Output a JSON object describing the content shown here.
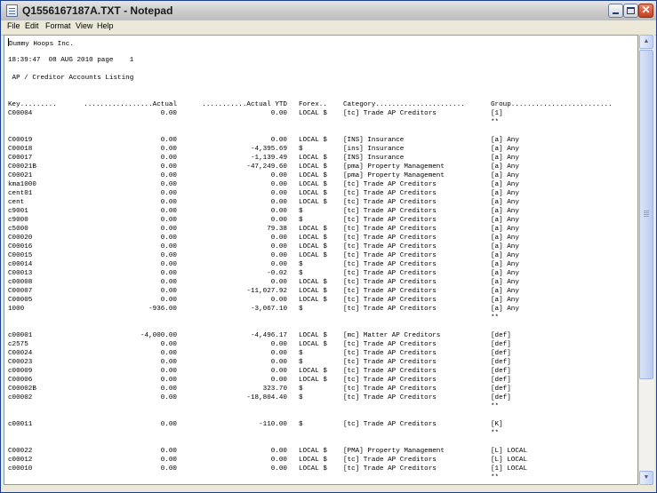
{
  "window": {
    "title": "Q1556167187A.TXT - Notepad"
  },
  "menu": [
    "File",
    "Edit",
    "Format",
    "View",
    "Help"
  ],
  "report": {
    "company": "Dummy Hoops Inc.",
    "header": "18:39:47  08 AUG 2010 page    1",
    "title": " AP / Creditor Accounts Listing",
    "columns": {
      "key": "Key.........",
      "actual": ".................Actual",
      "ytd": "...........Actual YTD",
      "forex": "Forex..",
      "category": "Category......................",
      "group": "Group........................."
    },
    "rows": [
      {
        "key": "C00004",
        "actual": "0.00",
        "ytd": "0.00",
        "forex": "LOCAL $",
        "category": "[tc] Trade AP Creditors",
        "group": "[1]"
      },
      {
        "subtotal": "**"
      },
      {
        "blank": true
      },
      {
        "key": "C00019",
        "actual": "0.00",
        "ytd": "0.00",
        "forex": "LOCAL $",
        "category": "[INS] Insurance",
        "group": "[a] Any"
      },
      {
        "key": "C00018",
        "actual": "0.00",
        "ytd": "-4,395.69",
        "forex": "$",
        "category": "[ins] Insurance",
        "group": "[a] Any"
      },
      {
        "key": "C00017",
        "actual": "0.00",
        "ytd": "-1,139.49",
        "forex": "LOCAL $",
        "category": "[INS] Insurance",
        "group": "[a] Any"
      },
      {
        "key": "C00021B",
        "actual": "0.00",
        "ytd": "-47,249.60",
        "forex": "LOCAL $",
        "category": "[pma] Property Management",
        "group": "[a] Any"
      },
      {
        "key": "C00021",
        "actual": "0.00",
        "ytd": "0.00",
        "forex": "LOCAL $",
        "category": "[pma] Property Management",
        "group": "[a] Any"
      },
      {
        "key": "kma1000",
        "actual": "0.00",
        "ytd": "0.00",
        "forex": "LOCAL $",
        "category": "[tc] Trade AP Creditors",
        "group": "[a] Any"
      },
      {
        "key": "cent01",
        "actual": "0.00",
        "ytd": "0.00",
        "forex": "LOCAL $",
        "category": "[tc] Trade AP Creditors",
        "group": "[a] Any"
      },
      {
        "key": "cent",
        "actual": "0.00",
        "ytd": "0.00",
        "forex": "LOCAL $",
        "category": "[tc] Trade AP Creditors",
        "group": "[a] Any"
      },
      {
        "key": "c9001",
        "actual": "0.00",
        "ytd": "0.00",
        "forex": "$",
        "category": "[tc] Trade AP Creditors",
        "group": "[a] Any"
      },
      {
        "key": "c9000",
        "actual": "0.00",
        "ytd": "0.00",
        "forex": "$",
        "category": "[tc] Trade AP Creditors",
        "group": "[a] Any"
      },
      {
        "key": "c5000",
        "actual": "0.00",
        "ytd": "79.38",
        "forex": "LOCAL $",
        "category": "[tc] Trade AP Creditors",
        "group": "[a] Any"
      },
      {
        "key": "C00020",
        "actual": "0.00",
        "ytd": "0.00",
        "forex": "LOCAL $",
        "category": "[tc] Trade AP Creditors",
        "group": "[a] Any"
      },
      {
        "key": "C00016",
        "actual": "0.00",
        "ytd": "0.00",
        "forex": "LOCAL $",
        "category": "[tc] Trade AP Creditors",
        "group": "[a] Any"
      },
      {
        "key": "C00015",
        "actual": "0.00",
        "ytd": "0.00",
        "forex": "LOCAL $",
        "category": "[tc] Trade AP Creditors",
        "group": "[a] Any"
      },
      {
        "key": "c00014",
        "actual": "0.00",
        "ytd": "0.00",
        "forex": "$",
        "category": "[tc] Trade AP Creditors",
        "group": "[a] Any"
      },
      {
        "key": "C00013",
        "actual": "0.00",
        "ytd": "-0.02",
        "forex": "$",
        "category": "[tc] Trade AP Creditors",
        "group": "[a] Any"
      },
      {
        "key": "c00008",
        "actual": "0.00",
        "ytd": "0.00",
        "forex": "LOCAL $",
        "category": "[tc] Trade AP Creditors",
        "group": "[a] Any"
      },
      {
        "key": "C00007",
        "actual": "0.00",
        "ytd": "-11,027.92",
        "forex": "LOCAL $",
        "category": "[tc] Trade AP Creditors",
        "group": "[a] Any"
      },
      {
        "key": "C00005",
        "actual": "0.00",
        "ytd": "0.00",
        "forex": "LOCAL $",
        "category": "[tc] Trade AP Creditors",
        "group": "[a] Any"
      },
      {
        "key": "1000",
        "actual": "-936.00",
        "ytd": "-3,067.10",
        "forex": "$",
        "category": "[tc] Trade AP Creditors",
        "group": "[a] Any"
      },
      {
        "subtotal": "**"
      },
      {
        "blank": true
      },
      {
        "key": "c00001",
        "actual": "-4,000.00",
        "ytd": "-4,496.17",
        "forex": "LOCAL $",
        "category": "[mc] Matter AP Creditors",
        "group": "[def]"
      },
      {
        "key": "c2575",
        "actual": "0.00",
        "ytd": "0.00",
        "forex": "LOCAL $",
        "category": "[tc] Trade AP Creditors",
        "group": "[def]"
      },
      {
        "key": "C00024",
        "actual": "0.00",
        "ytd": "0.00",
        "forex": "$",
        "category": "[tc] Trade AP Creditors",
        "group": "[def]"
      },
      {
        "key": "C00023",
        "actual": "0.00",
        "ytd": "0.00",
        "forex": "$",
        "category": "[tc] Trade AP Creditors",
        "group": "[def]"
      },
      {
        "key": "c00009",
        "actual": "0.00",
        "ytd": "0.00",
        "forex": "LOCAL $",
        "category": "[tc] Trade AP Creditors",
        "group": "[def]"
      },
      {
        "key": "C00006",
        "actual": "0.00",
        "ytd": "0.00",
        "forex": "LOCAL $",
        "category": "[tc] Trade AP Creditors",
        "group": "[def]"
      },
      {
        "key": "C00002B",
        "actual": "0.00",
        "ytd": "323.70",
        "forex": "$",
        "category": "[tc] Trade AP Creditors",
        "group": "[def]"
      },
      {
        "key": "c00002",
        "actual": "0.00",
        "ytd": "-18,804.40",
        "forex": "$",
        "category": "[tc] Trade AP Creditors",
        "group": "[def]"
      },
      {
        "subtotal": "**"
      },
      {
        "blank": true
      },
      {
        "key": "c00011",
        "actual": "0.00",
        "ytd": "-110.00",
        "forex": "$",
        "category": "[tc] Trade AP Creditors",
        "group": "[K]"
      },
      {
        "subtotal": "**"
      },
      {
        "blank": true
      },
      {
        "key": "C00022",
        "actual": "0.00",
        "ytd": "0.00",
        "forex": "LOCAL $",
        "category": "[PMA] Property Management",
        "group": "[L] LOCAL"
      },
      {
        "key": "c00012",
        "actual": "0.00",
        "ytd": "0.00",
        "forex": "LOCAL $",
        "category": "[tc] Trade AP Creditors",
        "group": "[L] LOCAL"
      },
      {
        "key": "c00010",
        "actual": "0.00",
        "ytd": "0.00",
        "forex": "LOCAL $",
        "category": "[tc] Trade AP Creditors",
        "group": "[1] LOCAL"
      },
      {
        "subtotal": "**"
      }
    ]
  },
  "scrollbar": {
    "up_icon": "arrow-up-icon",
    "down_icon": "arrow-down-icon"
  }
}
